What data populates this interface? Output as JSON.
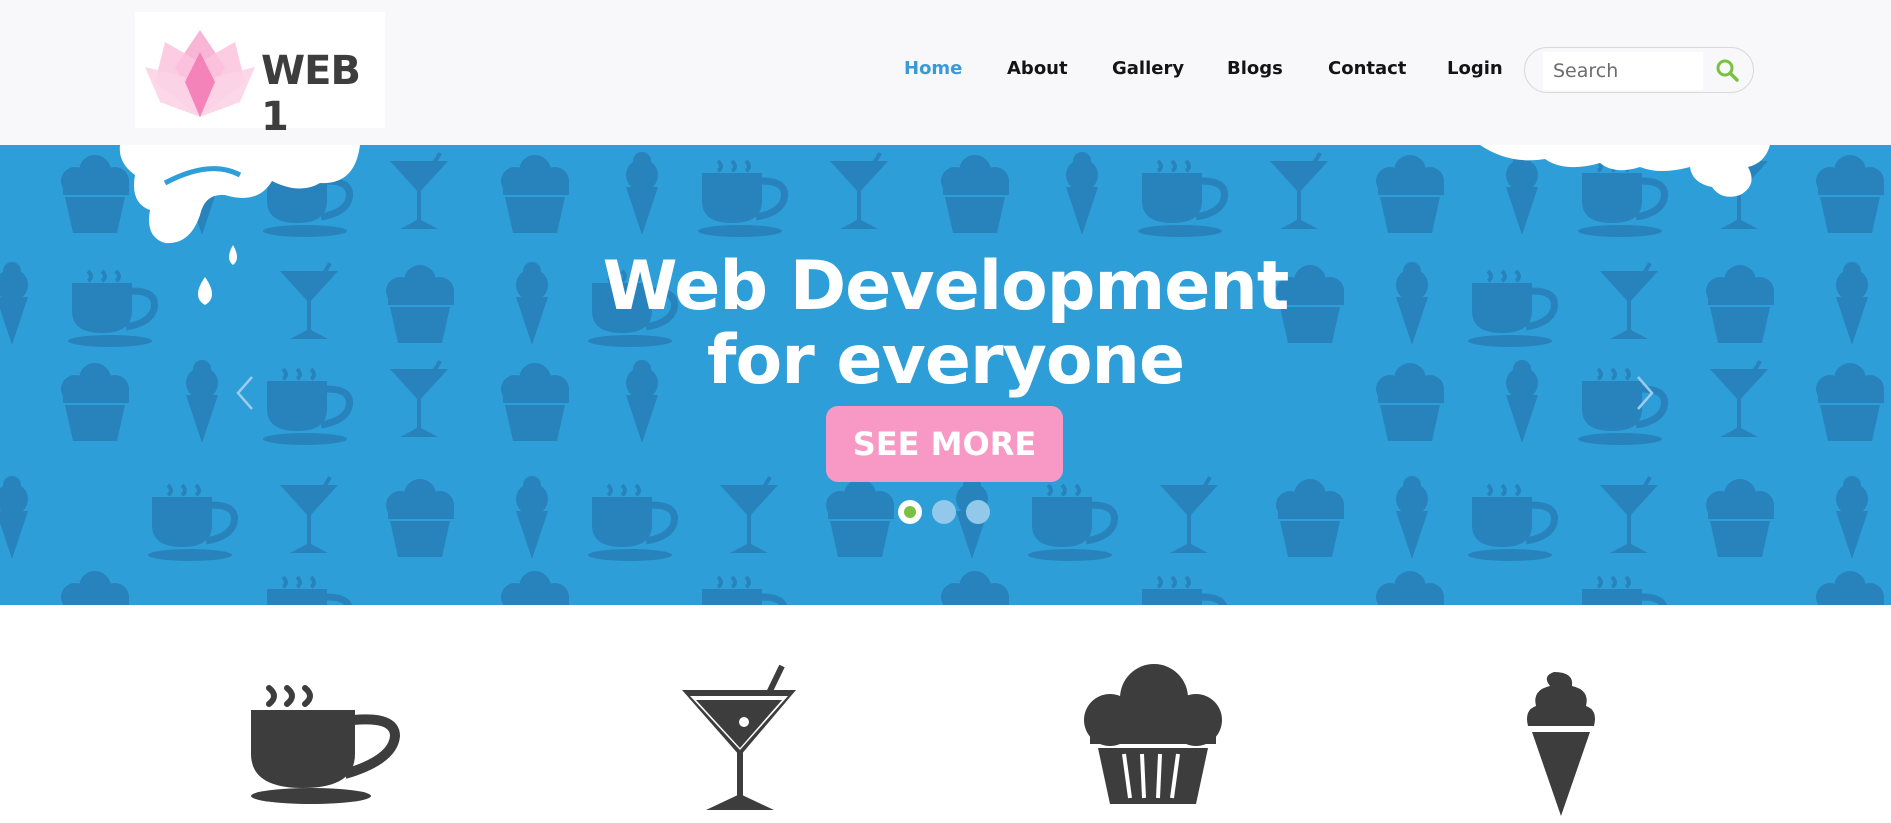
{
  "header": {
    "logo_text": "WEB 1",
    "nav": [
      {
        "label": "Home",
        "active": true
      },
      {
        "label": "About",
        "active": false
      },
      {
        "label": "Gallery",
        "active": false
      },
      {
        "label": "Blogs",
        "active": false
      },
      {
        "label": "Contact",
        "active": false
      },
      {
        "label": "Login",
        "active": false
      }
    ],
    "search": {
      "placeholder": "Search",
      "value": ""
    }
  },
  "hero": {
    "headline_line1": "Web Development",
    "headline_line2": "for everyone",
    "cta_label": "SEE MORE",
    "slide_count": 3,
    "active_slide": 1
  },
  "features": {
    "icons": [
      "coffee-cup-icon",
      "martini-glass-icon",
      "cupcake-icon",
      "ice-cream-cone-icon"
    ]
  },
  "colors": {
    "header_bg": "#f8f8fa",
    "hero_bg": "#2e9ed8",
    "nav_active": "#3a9ad9",
    "cta_bg": "#f799c4",
    "dot_active": "#7ac142",
    "icon_dark": "#3d3d3d"
  }
}
